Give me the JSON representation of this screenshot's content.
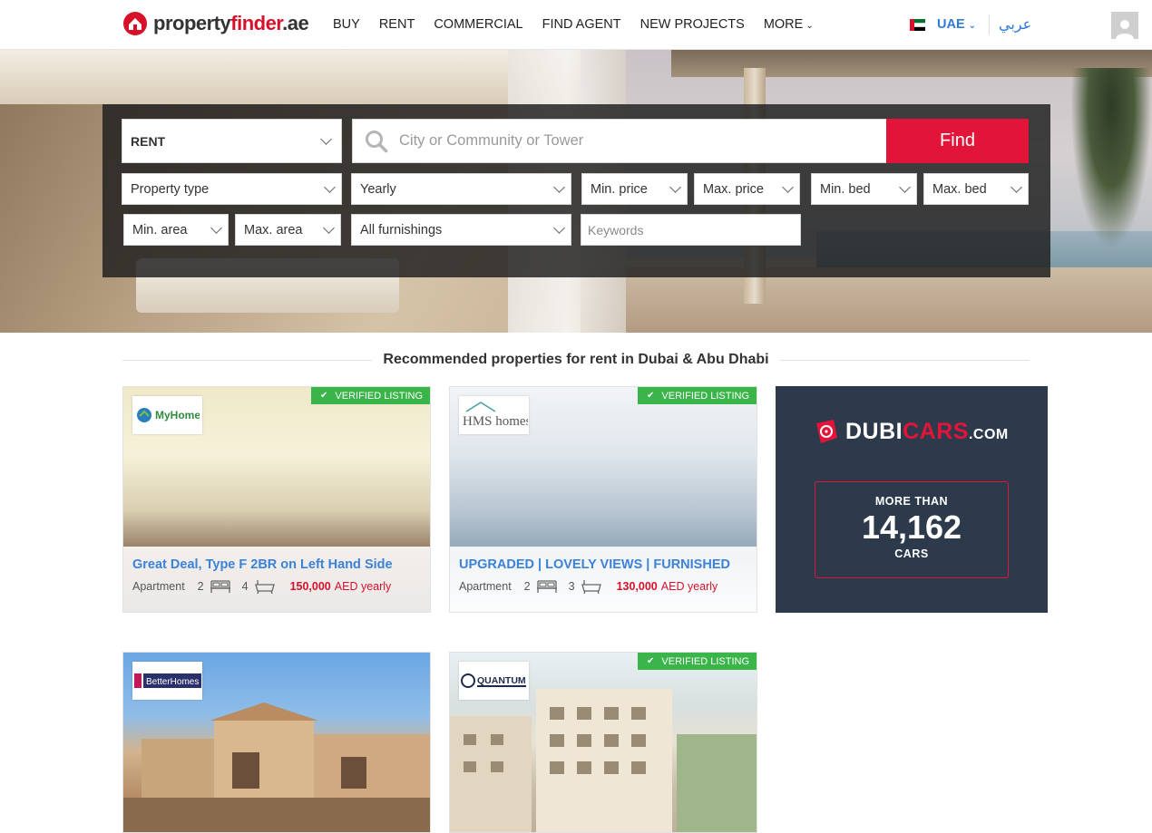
{
  "brand": {
    "logo_text_main": "property",
    "logo_text_accent": "finder",
    "logo_text_tld": ".ae",
    "color": "#d8112b"
  },
  "nav": {
    "items": [
      "BUY",
      "RENT",
      "COMMERCIAL",
      "FIND AGENT",
      "NEW PROJECTS",
      "MORE"
    ],
    "country": "UAE",
    "language": "عربي",
    "accent_color": "#2e7bd8"
  },
  "search": {
    "mode": "RENT",
    "location_placeholder": "City or Community or Tower",
    "find_label": "Find",
    "find_color": "#e3143a",
    "property_type": "Property type",
    "period": "Yearly",
    "min_price": "Min. price",
    "max_price": "Max. price",
    "min_bed": "Min. bed",
    "max_bed": "Max. bed",
    "min_area": "Min. area",
    "max_area": "Max. area",
    "furnishing": "All furnishings",
    "keywords_placeholder": "Keywords"
  },
  "section": {
    "title": "Recommended properties for rent in Dubai & Abu Dhabi"
  },
  "listings": [
    {
      "verified": "VERIFIED LISTING",
      "broker": "MyHome",
      "title": "Great Deal, Type F 2BR on Left Hand Side",
      "type": "Apartment",
      "beds": "2",
      "baths": "4",
      "price": "150,000",
      "price_unit": "AED yearly"
    },
    {
      "verified": "VERIFIED LISTING",
      "broker": "HMS homes",
      "title": "UPGRADED | LOVELY VIEWS | FURNISHED",
      "type": "Apartment",
      "beds": "2",
      "baths": "3",
      "price": "130,000",
      "price_unit": "AED yearly"
    },
    {
      "verified": "",
      "broker": "BetterHomes"
    },
    {
      "verified": "VERIFIED LISTING",
      "broker": "QUANTUM"
    }
  ],
  "ad": {
    "logo_part1": "DUBI",
    "logo_part2": "CARS",
    "logo_tld": ".COM",
    "line1": "MORE THAN",
    "count": "14,162",
    "line2": "CARS",
    "bg_color": "#2c3a4b"
  }
}
